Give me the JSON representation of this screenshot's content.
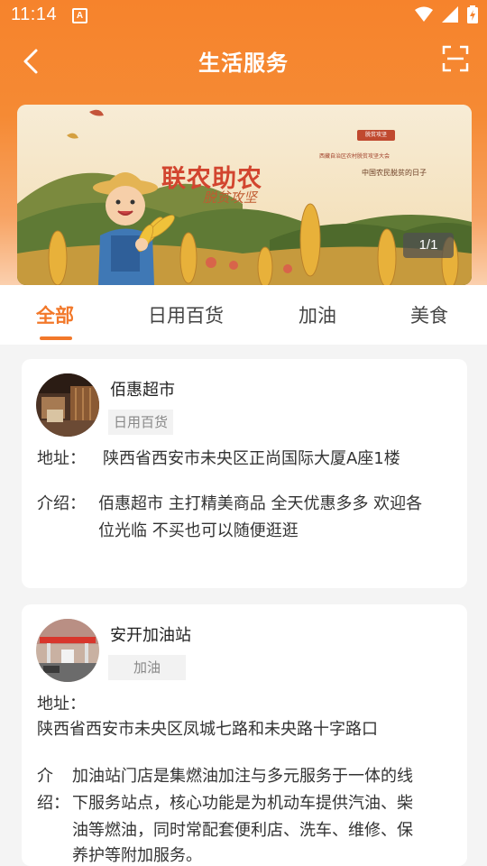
{
  "status_bar": {
    "time": "11:14",
    "notification_icon": "A"
  },
  "nav": {
    "title": "生活服务",
    "back_icon": "chevron-left-icon",
    "scan_icon": "scan-icon"
  },
  "banner": {
    "title": "联农助农",
    "subtitle": "脱贫攻坚",
    "tag": "脱贫攻坚",
    "line1": "西藏自治区农村脱贫攻坚大会",
    "line2": "中国农民脱贫的日子",
    "counter": "1/1"
  },
  "tabs": [
    {
      "label": "全部",
      "active": true
    },
    {
      "label": "日用百货",
      "active": false
    },
    {
      "label": "加油",
      "active": false
    },
    {
      "label": "美食",
      "active": false
    }
  ],
  "stores": [
    {
      "name": "佰惠超市",
      "tag": "日用百货",
      "address_label": "地址：",
      "address": "陕西省西安市未央区正尚国际大厦A座1楼",
      "intro_label": "介绍：",
      "intro_lines": [
        "佰惠超市 主打精美商品 全天优惠多多 欢迎各",
        "位光临 不买也可以随便逛逛"
      ]
    },
    {
      "name": "安开加油站",
      "tag": "加油",
      "address_label": "地址：",
      "address": "陕西省西安市未央区凤城七路和未央路十字路口",
      "intro_label_1": "介",
      "intro_label_2": "绍：",
      "intro_lines": [
        "加油站门店是集燃油加注与多元服务于一体的线",
        "下服务站点，核心功能是为机动车提供汽油、柴",
        "油等燃油，同时常配套便利店、洗车、维修、保",
        "养护等附加服务。"
      ]
    }
  ],
  "colors": {
    "accent": "#f2782a",
    "header": "#f6832c"
  }
}
